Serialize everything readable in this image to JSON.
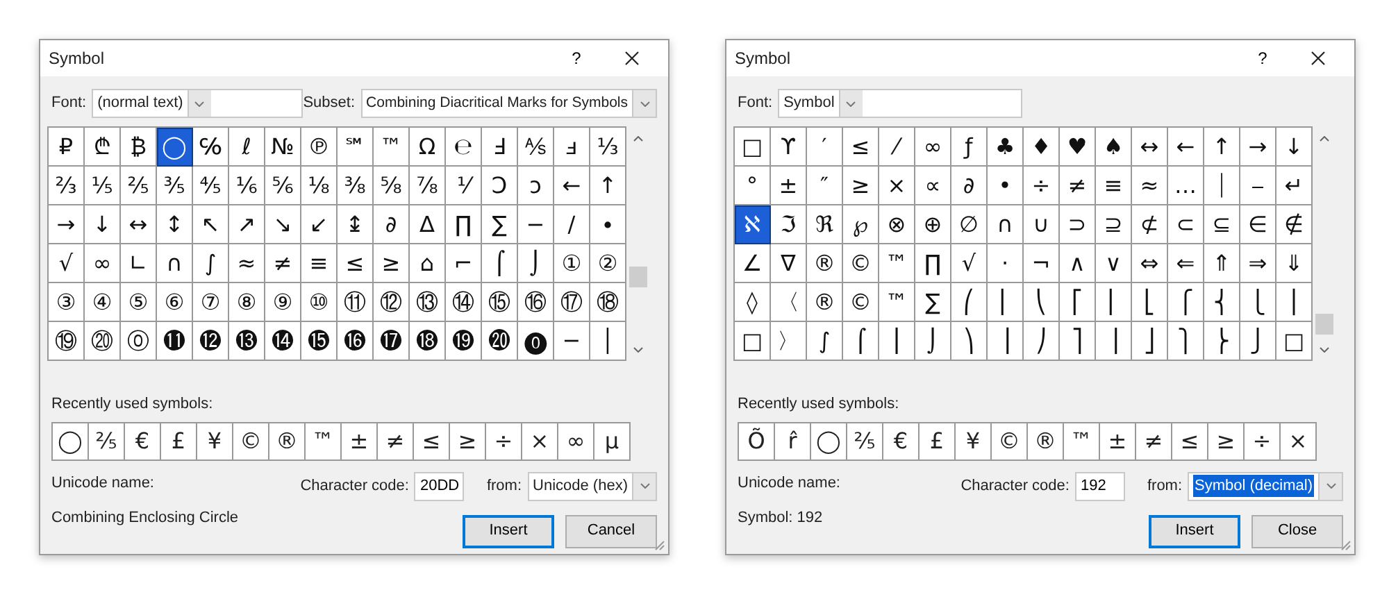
{
  "dialogs": [
    {
      "title": "Symbol",
      "help": "?",
      "font": {
        "label": "Font:",
        "value": "(normal text)"
      },
      "subset": {
        "label": "Subset:",
        "value": "Combining Diacritical Marks for Symbols"
      },
      "grid": [
        [
          {
            "c": "₽",
            "selected": false
          },
          {
            "c": "₾",
            "selected": false
          },
          {
            "c": "₿",
            "selected": false
          },
          {
            "c": "◯",
            "selected": true
          },
          {
            "c": "℅",
            "selected": false
          },
          {
            "c": "ℓ",
            "selected": false
          },
          {
            "c": "№",
            "selected": false
          },
          {
            "c": "℗",
            "selected": false
          },
          {
            "c": "℠",
            "selected": false
          },
          {
            "c": "™",
            "selected": false
          },
          {
            "c": "Ω",
            "selected": false
          },
          {
            "c": "℮",
            "selected": false
          },
          {
            "c": "Ⅎ",
            "selected": false
          },
          {
            "c": "⅍",
            "selected": false
          },
          {
            "c": "ⅎ",
            "selected": false
          },
          {
            "c": "⅓",
            "selected": false
          }
        ],
        [
          {
            "c": "⅔",
            "selected": false
          },
          {
            "c": "⅕",
            "selected": false
          },
          {
            "c": "⅖",
            "selected": false
          },
          {
            "c": "⅗",
            "selected": false
          },
          {
            "c": "⅘",
            "selected": false
          },
          {
            "c": "⅙",
            "selected": false
          },
          {
            "c": "⅚",
            "selected": false
          },
          {
            "c": "⅛",
            "selected": false
          },
          {
            "c": "⅜",
            "selected": false
          },
          {
            "c": "⅝",
            "selected": false
          },
          {
            "c": "⅞",
            "selected": false
          },
          {
            "c": "⅟",
            "selected": false
          },
          {
            "c": "Ↄ",
            "selected": false
          },
          {
            "c": "ↄ",
            "selected": false
          },
          {
            "c": "←",
            "selected": false
          },
          {
            "c": "↑",
            "selected": false
          }
        ],
        [
          {
            "c": "→",
            "selected": false
          },
          {
            "c": "↓",
            "selected": false
          },
          {
            "c": "↔",
            "selected": false
          },
          {
            "c": "↕",
            "selected": false
          },
          {
            "c": "↖",
            "selected": false
          },
          {
            "c": "↗",
            "selected": false
          },
          {
            "c": "↘",
            "selected": false
          },
          {
            "c": "↙",
            "selected": false
          },
          {
            "c": "↨",
            "selected": false
          },
          {
            "c": "∂",
            "selected": false
          },
          {
            "c": "∆",
            "selected": false
          },
          {
            "c": "∏",
            "selected": false
          },
          {
            "c": "∑",
            "selected": false
          },
          {
            "c": "−",
            "selected": false
          },
          {
            "c": "∕",
            "selected": false
          },
          {
            "c": "∙",
            "selected": false
          }
        ],
        [
          {
            "c": "√",
            "selected": false
          },
          {
            "c": "∞",
            "selected": false
          },
          {
            "c": "∟",
            "selected": false
          },
          {
            "c": "∩",
            "selected": false
          },
          {
            "c": "∫",
            "selected": false
          },
          {
            "c": "≈",
            "selected": false
          },
          {
            "c": "≠",
            "selected": false
          },
          {
            "c": "≡",
            "selected": false
          },
          {
            "c": "≤",
            "selected": false
          },
          {
            "c": "≥",
            "selected": false
          },
          {
            "c": "⌂",
            "selected": false
          },
          {
            "c": "⌐",
            "selected": false
          },
          {
            "c": "⌠",
            "selected": false
          },
          {
            "c": "⌡",
            "selected": false
          },
          {
            "c": "①",
            "selected": false
          },
          {
            "c": "②",
            "selected": false
          }
        ],
        [
          {
            "c": "③",
            "selected": false
          },
          {
            "c": "④",
            "selected": false
          },
          {
            "c": "⑤",
            "selected": false
          },
          {
            "c": "⑥",
            "selected": false
          },
          {
            "c": "⑦",
            "selected": false
          },
          {
            "c": "⑧",
            "selected": false
          },
          {
            "c": "⑨",
            "selected": false
          },
          {
            "c": "⑩",
            "selected": false
          },
          {
            "c": "⑪",
            "selected": false
          },
          {
            "c": "⑫",
            "selected": false
          },
          {
            "c": "⑬",
            "selected": false
          },
          {
            "c": "⑭",
            "selected": false
          },
          {
            "c": "⑮",
            "selected": false
          },
          {
            "c": "⑯",
            "selected": false
          },
          {
            "c": "⑰",
            "selected": false
          },
          {
            "c": "⑱",
            "selected": false
          }
        ],
        [
          {
            "c": "⑲",
            "selected": false
          },
          {
            "c": "⑳",
            "selected": false
          },
          {
            "c": "⓪",
            "selected": false
          },
          {
            "c": "⓫",
            "selected": false
          },
          {
            "c": "⓬",
            "selected": false
          },
          {
            "c": "⓭",
            "selected": false
          },
          {
            "c": "⓮",
            "selected": false
          },
          {
            "c": "⓯",
            "selected": false
          },
          {
            "c": "⓰",
            "selected": false
          },
          {
            "c": "⓱",
            "selected": false
          },
          {
            "c": "⓲",
            "selected": false
          },
          {
            "c": "⓳",
            "selected": false
          },
          {
            "c": "⓴",
            "selected": false
          },
          {
            "c": "⓿",
            "selected": false
          },
          {
            "c": "─",
            "selected": false
          },
          {
            "c": "│",
            "selected": false
          }
        ]
      ],
      "recent_label": "Recently used symbols:",
      "recent": [
        "◯",
        "⅖",
        "€",
        "£",
        "¥",
        "©",
        "®",
        "™",
        "±",
        "≠",
        "≤",
        "≥",
        "÷",
        "×",
        "∞",
        "µ"
      ],
      "unicode_name_label": "Unicode name:",
      "unicode_name": "Combining Enclosing Circle",
      "char_code": {
        "label": "Character code:",
        "value": "20DD"
      },
      "from": {
        "label": "from:",
        "value": "Unicode (hex)",
        "highlighted": false
      },
      "buttons": [
        {
          "label": "Insert",
          "default": true
        },
        {
          "label": "Cancel",
          "default": false
        }
      ]
    },
    {
      "title": "Symbol",
      "help": "?",
      "font": {
        "label": "Font:",
        "value": "Symbol"
      },
      "grid": [
        [
          {
            "c": "□",
            "selected": false
          },
          {
            "c": "ϒ",
            "selected": false
          },
          {
            "c": "′",
            "selected": false
          },
          {
            "c": "≤",
            "selected": false
          },
          {
            "c": "⁄",
            "selected": false
          },
          {
            "c": "∞",
            "selected": false
          },
          {
            "c": "ƒ",
            "selected": false
          },
          {
            "c": "♣",
            "selected": false
          },
          {
            "c": "♦",
            "selected": false
          },
          {
            "c": "♥",
            "selected": false
          },
          {
            "c": "♠",
            "selected": false
          },
          {
            "c": "↔",
            "selected": false
          },
          {
            "c": "←",
            "selected": false
          },
          {
            "c": "↑",
            "selected": false
          },
          {
            "c": "→",
            "selected": false
          },
          {
            "c": "↓",
            "selected": false
          }
        ],
        [
          {
            "c": "°",
            "selected": false
          },
          {
            "c": "±",
            "selected": false
          },
          {
            "c": "″",
            "selected": false
          },
          {
            "c": "≥",
            "selected": false
          },
          {
            "c": "×",
            "selected": false
          },
          {
            "c": "∝",
            "selected": false
          },
          {
            "c": "∂",
            "selected": false
          },
          {
            "c": "•",
            "selected": false
          },
          {
            "c": "÷",
            "selected": false
          },
          {
            "c": "≠",
            "selected": false
          },
          {
            "c": "≡",
            "selected": false
          },
          {
            "c": "≈",
            "selected": false
          },
          {
            "c": "…",
            "selected": false
          },
          {
            "c": "⏐",
            "selected": false
          },
          {
            "c": "⎯",
            "selected": false
          },
          {
            "c": "↵",
            "selected": false
          }
        ],
        [
          {
            "c": "ℵ",
            "selected": true
          },
          {
            "c": "ℑ",
            "selected": false
          },
          {
            "c": "ℜ",
            "selected": false
          },
          {
            "c": "℘",
            "selected": false
          },
          {
            "c": "⊗",
            "selected": false
          },
          {
            "c": "⊕",
            "selected": false
          },
          {
            "c": "∅",
            "selected": false
          },
          {
            "c": "∩",
            "selected": false
          },
          {
            "c": "∪",
            "selected": false
          },
          {
            "c": "⊃",
            "selected": false
          },
          {
            "c": "⊇",
            "selected": false
          },
          {
            "c": "⊄",
            "selected": false
          },
          {
            "c": "⊂",
            "selected": false
          },
          {
            "c": "⊆",
            "selected": false
          },
          {
            "c": "∈",
            "selected": false
          },
          {
            "c": "∉",
            "selected": false
          }
        ],
        [
          {
            "c": "∠",
            "selected": false
          },
          {
            "c": "∇",
            "selected": false
          },
          {
            "c": "®",
            "selected": false
          },
          {
            "c": "©",
            "selected": false
          },
          {
            "c": "™",
            "selected": false
          },
          {
            "c": "∏",
            "selected": false
          },
          {
            "c": "√",
            "selected": false
          },
          {
            "c": "⋅",
            "selected": false
          },
          {
            "c": "¬",
            "selected": false
          },
          {
            "c": "∧",
            "selected": false
          },
          {
            "c": "∨",
            "selected": false
          },
          {
            "c": "⇔",
            "selected": false
          },
          {
            "c": "⇐",
            "selected": false
          },
          {
            "c": "⇑",
            "selected": false
          },
          {
            "c": "⇒",
            "selected": false
          },
          {
            "c": "⇓",
            "selected": false
          }
        ],
        [
          {
            "c": "◊",
            "selected": false
          },
          {
            "c": "〈",
            "selected": false
          },
          {
            "c": "®",
            "selected": false
          },
          {
            "c": "©",
            "selected": false
          },
          {
            "c": "™",
            "selected": false
          },
          {
            "c": "∑",
            "selected": false
          },
          {
            "c": "⎛",
            "selected": false
          },
          {
            "c": "⎜",
            "selected": false
          },
          {
            "c": "⎝",
            "selected": false
          },
          {
            "c": "⎡",
            "selected": false
          },
          {
            "c": "⎢",
            "selected": false
          },
          {
            "c": "⎣",
            "selected": false
          },
          {
            "c": "⎧",
            "selected": false
          },
          {
            "c": "⎨",
            "selected": false
          },
          {
            "c": "⎩",
            "selected": false
          },
          {
            "c": "⎪",
            "selected": false
          }
        ],
        [
          {
            "c": "□",
            "selected": false
          },
          {
            "c": "〉",
            "selected": false
          },
          {
            "c": "∫",
            "selected": false
          },
          {
            "c": "⌠",
            "selected": false
          },
          {
            "c": "⎮",
            "selected": false
          },
          {
            "c": "⌡",
            "selected": false
          },
          {
            "c": "⎞",
            "selected": false
          },
          {
            "c": "⎟",
            "selected": false
          },
          {
            "c": "⎠",
            "selected": false
          },
          {
            "c": "⎤",
            "selected": false
          },
          {
            "c": "⎥",
            "selected": false
          },
          {
            "c": "⎦",
            "selected": false
          },
          {
            "c": "⎫",
            "selected": false
          },
          {
            "c": "⎬",
            "selected": false
          },
          {
            "c": "⎭",
            "selected": false
          },
          {
            "c": "□",
            "selected": false
          }
        ]
      ],
      "recent_label": "Recently used symbols:",
      "recent": [
        "Õ",
        "r̂",
        "◯",
        "⅖",
        "€",
        "£",
        "¥",
        "©",
        "®",
        "™",
        "±",
        "≠",
        "≤",
        "≥",
        "÷",
        "×"
      ],
      "unicode_name_label": "Unicode name:",
      "unicode_name": "Symbol: 192",
      "char_code": {
        "label": "Character code:",
        "value": "192"
      },
      "from": {
        "label": "from:",
        "value": "Symbol (decimal)",
        "highlighted": true
      },
      "buttons": [
        {
          "label": "Insert",
          "default": true
        },
        {
          "label": "Close",
          "default": false
        }
      ]
    }
  ]
}
